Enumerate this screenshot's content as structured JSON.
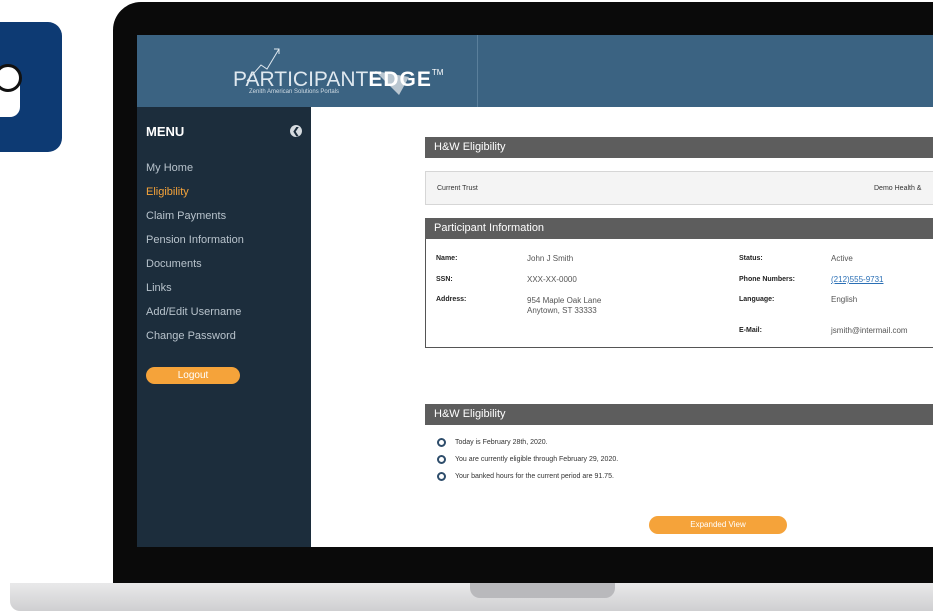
{
  "header": {
    "logo_prefix": "PARTICIPANT",
    "logo_bold": "EDGE",
    "logo_tm": "TM",
    "logo_subtitle": "Zenith American Solutions Portals"
  },
  "sidebar": {
    "menu_title": "MENU",
    "items": [
      {
        "label": "My Home"
      },
      {
        "label": "Eligibility"
      },
      {
        "label": "Claim Payments"
      },
      {
        "label": "Pension Information"
      },
      {
        "label": "Documents"
      },
      {
        "label": "Links"
      },
      {
        "label": "Add/Edit Username"
      },
      {
        "label": "Change Password"
      }
    ],
    "active_item": "Eligibility",
    "logout_label": "Logout"
  },
  "hw_section": {
    "title": "H&W Eligibility",
    "current_trust_label": "Current Trust",
    "current_trust_value": "Demo Health &"
  },
  "participant": {
    "title": "Participant Information",
    "name_label": "Name:",
    "name_value": "John J Smith",
    "ssn_label": "SSN:",
    "ssn_value": "XXX-XX-0000",
    "address_label": "Address:",
    "address_line1": "954 Maple Oak Lane",
    "address_line2": "Anytown, ST 33333",
    "status_label": "Status:",
    "status_value": "Active",
    "phone_label": "Phone Numbers:",
    "phone_value": "(212)555-9731",
    "language_label": "Language:",
    "language_value": "English",
    "email_label": "E-Mail:",
    "email_value": "jsmith@intermail.com"
  },
  "eligibility": {
    "title": "H&W Eligibility",
    "items": [
      "Today is February 28th, 2020.",
      "You are currently eligible through February 29, 2020.",
      "Your banked hours for the current period are 91.75."
    ],
    "expanded_view_label": "Expanded View"
  },
  "colors": {
    "header_bg": "#3b6382",
    "sidebar_bg": "#1c2d3c",
    "accent": "#f5a33a",
    "section_header_bg": "#5d5d5d",
    "link": "#2a6fb5"
  }
}
